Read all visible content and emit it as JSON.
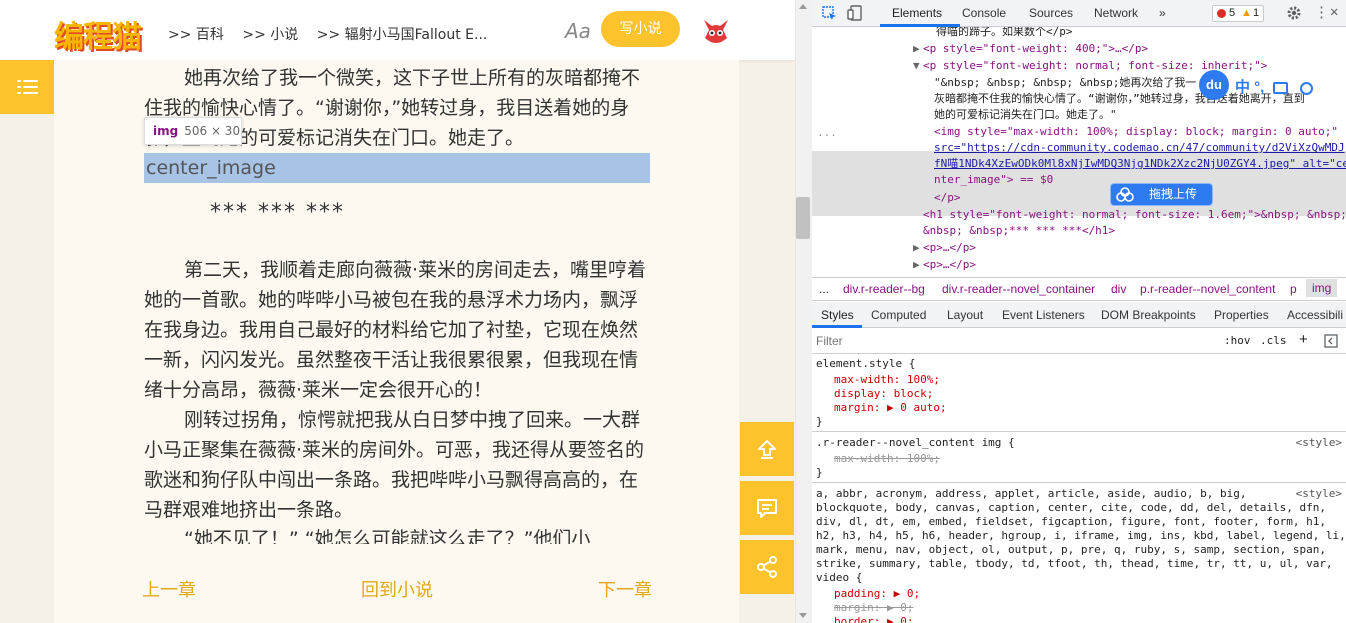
{
  "site": {
    "logo": "编程猫",
    "crumbs": [
      ">> 百科",
      ">> 小说",
      ">> 辐射小马国Fallout E..."
    ],
    "font_toggle": "Aa",
    "write_button": "写小说"
  },
  "reader": {
    "para1": "她再次给了我一个微笑，这下子世上所有的灰暗都掩不住我的愉快心情了。“谢谢你，”她转过身，我目送着她的身影，直到她的可爱标记消失在门口。她走了。",
    "image_alt": "center_image",
    "tooltip_tag": "img",
    "tooltip_size": "506 × 30",
    "separator": "*** *** ***",
    "para2": "第二天，我顺着走廊向薇薇·莱米的房间走去，嘴里哼着她的一首歌。她的哔哔小马被包在我的悬浮术力场内，飘浮在我身边。我用自己最好的材料给它加了衬垫，它现在焕然一新，闪闪发光。虽然整夜干活让我很累很累，但我现在情绪十分高昂，薇薇·莱米一定会很开心的！",
    "para3": "刚转过拐角，惊愕就把我从白日梦中拽了回来。一大群小马正聚集在薇薇·莱米的房间外。可恶，我还得从要签名的歌迷和狗仔队中闯出一条路。我把哔哔小马飘得高高的，在马群艰难地挤出一条路。",
    "para4": "“她不见了！” “她怎么可能就这么走了？”他们小",
    "prev": "上一章",
    "back": "回到小说",
    "next": "下一章"
  },
  "devtools": {
    "tabs": [
      "Elements",
      "Console",
      "Sources",
      "Network",
      "»"
    ],
    "errors": "5",
    "warnings": "1",
    "dom_lines": [
      "得喵的蹄子。如果数个</p>",
      "<p style=\"font-weight: 400;\">…</p>",
      "<p style=\"font-weight: normal; font-size: inherit;\">",
      "\"&nbsp; &nbsp; &nbsp; &nbsp;她再次给了我一",
      "灰暗都掩不住我的愉快心情了。“谢谢你，”她转过身，我目送着她离开，直到",
      "她的可爱标记消失在门口。她走了。\"",
      "<img style=\"max-width: 100%; display: block; margin: 0 auto;\"",
      "src=\"https://cdn-community.codemao.cn/47/community/d2ViXzQwMDJ",
      "fN喵1NDk4XzEwODk0Ml8xNjIwMDQ3Njg1NDk2Xzc2NjU0ZGY4.jpeg\" alt=\"ce",
      "nter_image\"> == $0",
      "</p>",
      "<h1 style=\"font-weight: normal; font-size: 1.6em;\">&nbsp; &nbsp;",
      "&nbsp; &nbsp;*** *** ***</h1>",
      "<p>…</p>",
      "<p>…</p>"
    ],
    "breadcrumbs": [
      "...",
      "div.r-reader--bg",
      "div.r-reader--novel_container",
      "div",
      "p.r-reader--novel_content",
      "p",
      "img"
    ],
    "subtabs": [
      "Styles",
      "Computed",
      "Layout",
      "Event Listeners",
      "DOM Breakpoints",
      "Properties",
      "Accessibili"
    ],
    "filter_placeholder": "Filter",
    "hov": ":hov",
    "cls": ".cls",
    "rule1": {
      "selector": "element.style {",
      "props": [
        "max-width: 100%;",
        "display: block;",
        "margin: ▶ 0 auto;"
      ],
      "close": "}"
    },
    "rule2": {
      "selector": ".r-reader--novel_content img {",
      "source": "<style>",
      "props": [
        "max-width: 100%;"
      ],
      "close": "}"
    },
    "rule3": {
      "selector_lines": [
        "a, abbr, acronym, address, applet, article, aside, audio, b, big,",
        "blockquote, body, canvas, caption, center, cite, code, dd, del, details, dfn,",
        "div, dl, dt, em, embed, fieldset, figcaption, figure, font, footer, form, h1,",
        "h2, h3, h4, h5, h6, header, hgroup, i, iframe, img, ins, kbd, label, legend, li,",
        "mark, menu, nav, object, ol, output, p, pre, q, ruby, s, samp, section, span,",
        "strike, summary, table, tbody, td, tfoot, th, thead, time, tr, tt, u, ul, var,",
        "video {"
      ],
      "source": "<style>",
      "props": [
        "padding: ▶ 0;",
        "margin: ▶ 0;",
        "border: ▶ 0;"
      ]
    }
  },
  "overlay": {
    "baidu_logo": "du",
    "baidu_bar": "中 °, ",
    "upload_button": "拖拽上传"
  }
}
